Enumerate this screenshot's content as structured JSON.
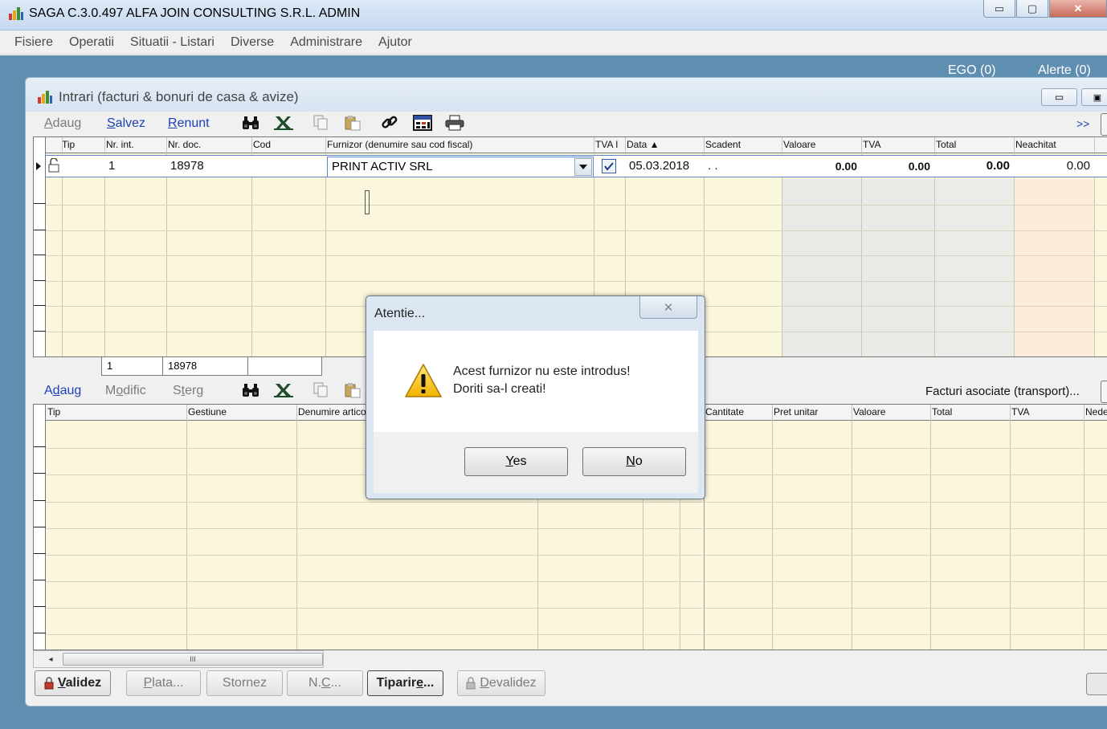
{
  "app": {
    "title": "SAGA C.3.0.497  ALFA JOIN CONSULTING S.R.L.  ADMIN",
    "min_symbol": "▭",
    "max_symbol": "▢",
    "close_symbol": "✕"
  },
  "menu": [
    "Fisiere",
    "Operatii",
    "Situatii - Listari",
    "Diverse",
    "Administrare",
    "Ajutor"
  ],
  "status": {
    "ego": "EGO (0)",
    "alerts": "Alerte (0)"
  },
  "inner_window": {
    "title": "Intrari (facturi & bonuri de casa & avize)",
    "min_symbol": "▭",
    "max_symbol": "▣"
  },
  "toolbar1": {
    "add": {
      "pre": "",
      "key": "A",
      "post": "daug"
    },
    "save": {
      "pre": "",
      "key": "S",
      "post": "alvez"
    },
    "cancel": {
      "pre": "",
      "key": "R",
      "post": "enunt"
    },
    "more": ">>"
  },
  "grid1": {
    "columns": [
      "Tip",
      "Nr. int.",
      "Nr. doc.",
      "Cod",
      "Furnizor (denumire sau cod fiscal)",
      "TVA I",
      "Data ▲",
      "Scadent",
      "Valoare",
      "TVA",
      "Total",
      "Neachitat"
    ],
    "row": {
      "tip": "",
      "nr_int": "1",
      "nr_doc": "18978",
      "cod": "",
      "furnizor": "PRINT ACTIV SRL",
      "tva_checked": true,
      "data": "05.03.2018",
      "scadent": ". .",
      "valoare": "0.00",
      "tva": "0.00",
      "total": "0.00",
      "neachitat": "0.00"
    },
    "totals": {
      "nr_int": "1",
      "nr_doc": "18978"
    }
  },
  "toolbar2": {
    "add": {
      "pre": "A",
      "key": "d",
      "post": "aug"
    },
    "edit": {
      "pre": "M",
      "key": "o",
      "post": "dific"
    },
    "delete": {
      "pre": "S",
      "key": "t",
      "post": "erg"
    },
    "linked": "Facturi asociate (transport)..."
  },
  "grid2": {
    "columns": [
      "Tip",
      "Gestiune",
      "Denumire articol",
      "Cantitate",
      "Pret unitar",
      "Valoare",
      "Total",
      "TVA",
      "Nede"
    ]
  },
  "scrollbar": {
    "thumb_grip": "III",
    "left_arrow": "◂"
  },
  "bottom_buttons": {
    "validate": {
      "pre": "",
      "key": "V",
      "post": "alidez"
    },
    "pay": {
      "pre": "",
      "key": "P",
      "post": "lata..."
    },
    "reverse": "Stornez",
    "credit_note": {
      "pre": "N.",
      "key": "C",
      "post": "..."
    },
    "print": {
      "pre": "Tiparir",
      "key": "e",
      "post": "..."
    },
    "invalidate": {
      "pre": "",
      "key": "D",
      "post": "evalidez"
    }
  },
  "dialog": {
    "title": "Atentie...",
    "line1": "Acest furnizor nu este introdus!",
    "line2": "Doriti sa-l creati!",
    "yes": {
      "pre": "",
      "key": "Y",
      "post": "es"
    },
    "no": {
      "pre": "",
      "key": "N",
      "post": "o"
    },
    "close_symbol": "✕"
  },
  "colors": {
    "desktop": "#5f8fb0",
    "grid_bg": "#fbf7dc",
    "link_blue": "#1c3fb5",
    "disabled": "#7b7b7b"
  }
}
